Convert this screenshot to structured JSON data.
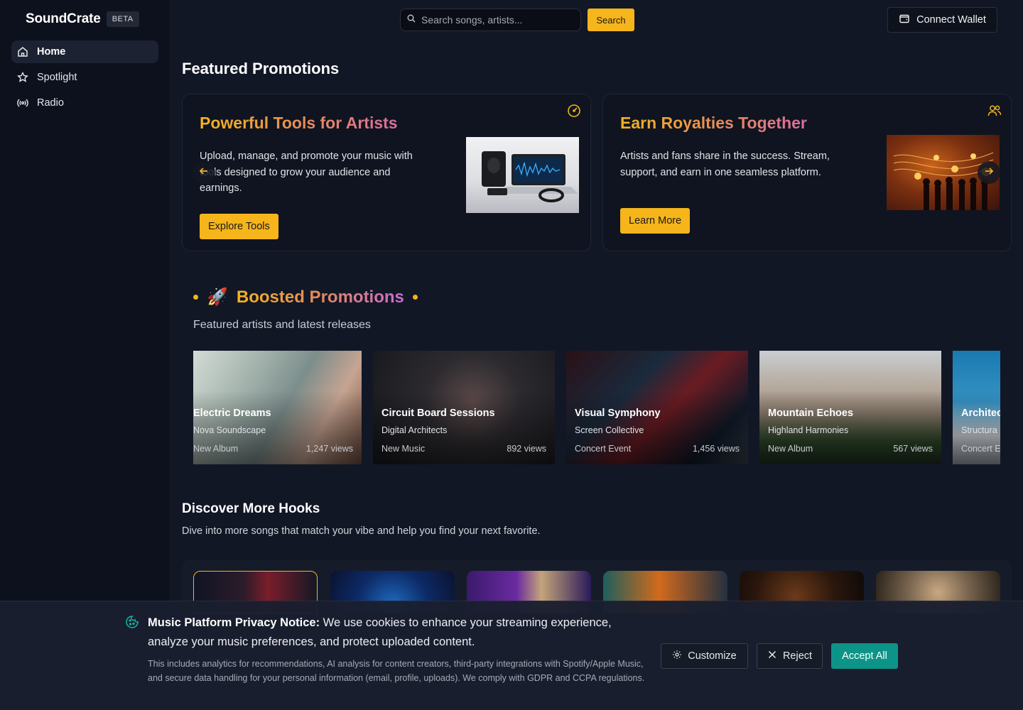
{
  "brand": {
    "name": "SoundCrate",
    "badge": "BETA"
  },
  "sidebar": {
    "items": [
      {
        "label": "Home",
        "icon": "home-icon",
        "active": true
      },
      {
        "label": "Spotlight",
        "icon": "star-icon",
        "active": false
      },
      {
        "label": "Radio",
        "icon": "radio-icon",
        "active": false
      }
    ]
  },
  "header": {
    "search_placeholder": "Search songs, artists...",
    "search_button": "Search",
    "wallet_button": "Connect Wallet"
  },
  "featured": {
    "title": "Featured Promotions",
    "cards": [
      {
        "title": "Powerful Tools for Artists",
        "description": "Upload, manage, and promote your music with tools designed to grow your audience and earnings.",
        "button": "Explore Tools",
        "corner_icon": "gauge-icon",
        "image": "laptop-speaker-image"
      },
      {
        "title": "Earn Royalties Together",
        "description": "Artists and fans share in the success. Stream, support, and earn in one seamless platform.",
        "button": "Learn More",
        "corner_icon": "users-icon",
        "image": "music-notes-crowd-image"
      }
    ]
  },
  "boosted": {
    "title": "Boosted Promotions",
    "emoji": "🚀",
    "subtitle": "Featured artists and latest releases",
    "items": [
      {
        "title": "Electric Dreams",
        "artist": "Nova Soundscape",
        "type": "New Album",
        "views": "1,247 views"
      },
      {
        "title": "Circuit Board Sessions",
        "artist": "Digital Architects",
        "type": "New Music",
        "views": "892 views"
      },
      {
        "title": "Visual Symphony",
        "artist": "Screen Collective",
        "type": "Concert Event",
        "views": "1,456 views"
      },
      {
        "title": "Mountain Echoes",
        "artist": "Highland Harmonies",
        "type": "New Album",
        "views": "567 views"
      },
      {
        "title": "Architec",
        "artist": "Structura",
        "type": "Concert E",
        "views": ""
      }
    ]
  },
  "discover": {
    "title": "Discover More Hooks",
    "subtitle": "Dive into more songs that match your vibe and help you find your next favorite."
  },
  "cookie": {
    "heading": "Music Platform Privacy Notice:",
    "message": " We use cookies to enhance your streaming experience, analyze your music preferences, and protect uploaded content.",
    "detail": "This includes analytics for recommendations, AI analysis for content creators, third-party integrations with Spotify/Apple Music, and secure data handling for your personal information (email, profile, uploads). We comply with GDPR and CCPA regulations.",
    "customize": "Customize",
    "reject": "Reject",
    "accept": "Accept All"
  },
  "colors": {
    "accent": "#f5b51b",
    "accept": "#0d9488",
    "background": "#121726"
  }
}
